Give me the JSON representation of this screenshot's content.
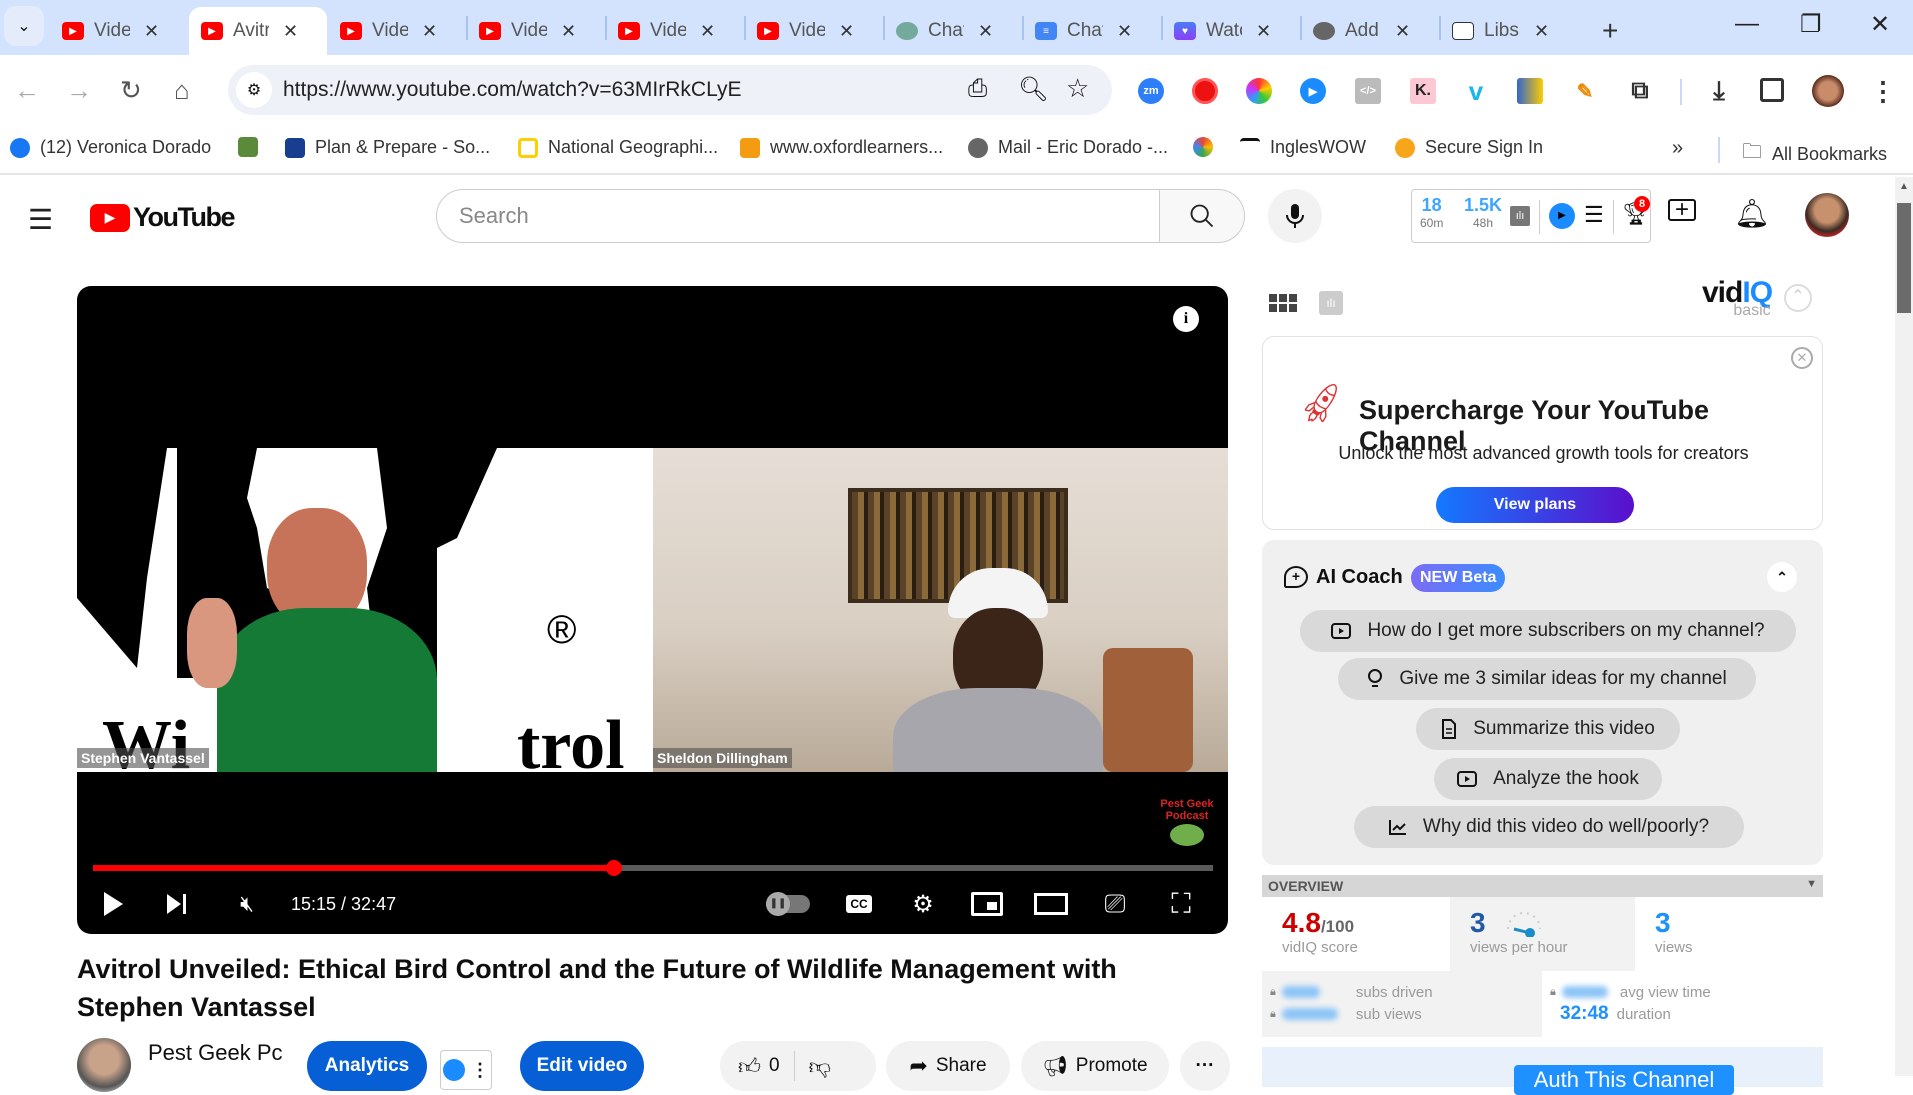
{
  "browser": {
    "tabs": [
      {
        "label": "Vide",
        "icon": "youtube",
        "active": false
      },
      {
        "label": "Avitr",
        "icon": "youtube",
        "active": true
      },
      {
        "label": "Vide",
        "icon": "youtube",
        "active": false
      },
      {
        "label": "Vide",
        "icon": "youtube",
        "active": false
      },
      {
        "label": "Vide",
        "icon": "youtube",
        "active": false
      },
      {
        "label": "Vide",
        "icon": "youtube",
        "active": false
      },
      {
        "label": "Chat",
        "icon": "chatgpt",
        "active": false
      },
      {
        "label": "Chat",
        "icon": "docs",
        "active": false
      },
      {
        "label": "Watc",
        "icon": "heart",
        "active": false
      },
      {
        "label": "Add",
        "icon": "globe",
        "active": false
      },
      {
        "label": "Libs",
        "icon": "libs",
        "active": false
      }
    ],
    "close_glyph": "✕",
    "new_tab_glyph": "+",
    "url": "https://www.youtube.com/watch?v=63MIrRkCLyE",
    "extensions": [
      "zoom",
      "record",
      "camera",
      "vidiq",
      "code",
      "kami",
      "vimeo",
      "brain",
      "edit",
      "puzzle"
    ],
    "bookmarks": [
      {
        "label": "(12) Veronica Dorado",
        "icon": "facebook"
      },
      {
        "label": "",
        "icon": "tree"
      },
      {
        "label": "Plan & Prepare - So...",
        "icon": "ssa"
      },
      {
        "label": "National Geographi...",
        "icon": "natgeo"
      },
      {
        "label": "www.oxfordlearners...",
        "icon": "oxford"
      },
      {
        "label": "Mail - Eric Dorado -...",
        "icon": "globe"
      },
      {
        "label": "",
        "icon": "pinwheel"
      },
      {
        "label": "InglesWOW",
        "icon": "ingles"
      },
      {
        "label": "Secure Sign In",
        "icon": "asterisk"
      }
    ],
    "bookmarks_more": "»",
    "all_bookmarks": "All Bookmarks"
  },
  "youtube": {
    "logo_text": "YouTube",
    "search_placeholder": "Search",
    "vidiq_bar": {
      "stat1_value": "18",
      "stat1_label": "60m",
      "stat2_value": "1.5K",
      "stat2_label": "48h",
      "trophy_badge": "8"
    },
    "player": {
      "current_time": "15:15",
      "duration": "32:47",
      "time_display": "15:15 / 32:47",
      "progress_fraction": 0.465,
      "participant_left": "Stephen Vantassel",
      "participant_right": "Sheldon Dillingham",
      "background_text": "trol",
      "watermark_line1": "Pest Geek",
      "watermark_line2": "Podcast",
      "muted": true,
      "autoplay": "on"
    },
    "video_title": "Avitrol Unveiled: Ethical Bird Control and the Future of Wildlife Management with Stephen Vantassel",
    "channel_name": "Pest Geek Pc",
    "buttons": {
      "analytics": "Analytics",
      "edit_video": "Edit video",
      "like_count": "0",
      "share": "Share",
      "promote": "Promote",
      "more": "···"
    }
  },
  "vidiq": {
    "brand": "vidIQ",
    "tier": "basic",
    "promo": {
      "title": "Supercharge Your YouTube Channel",
      "subtitle": "Unlock the most advanced growth tools for creators",
      "cta": "View plans"
    },
    "ai_coach": {
      "title": "AI Coach",
      "badge": "NEW Beta",
      "prompts": [
        {
          "label": "How do I get more subscribers on my channel?",
          "icon": "play-box"
        },
        {
          "label": "Give me 3 similar ideas for my channel",
          "icon": "lightbulb"
        },
        {
          "label": "Summarize this video",
          "icon": "document"
        },
        {
          "label": "Analyze the hook",
          "icon": "play-box"
        },
        {
          "label": "Why did this video do well/poorly?",
          "icon": "chart-line"
        }
      ]
    },
    "overview": {
      "header": "OVERVIEW",
      "score_value": "4.8",
      "score_max": "/100",
      "score_label": "vidIQ score",
      "vph_value": "3",
      "vph_label": "views per hour",
      "views_value": "3",
      "views_label": "views",
      "subs_driven_label": "subs driven",
      "sub_views_label": "sub views",
      "avg_view_time_label": "avg view time",
      "duration_value": "32:48",
      "duration_label": "duration",
      "auth_button": "Auth This Channel"
    },
    "colors": {
      "accent": "#1a73e8",
      "score": "#cc0000",
      "blue_value": "#1e90ff"
    }
  }
}
